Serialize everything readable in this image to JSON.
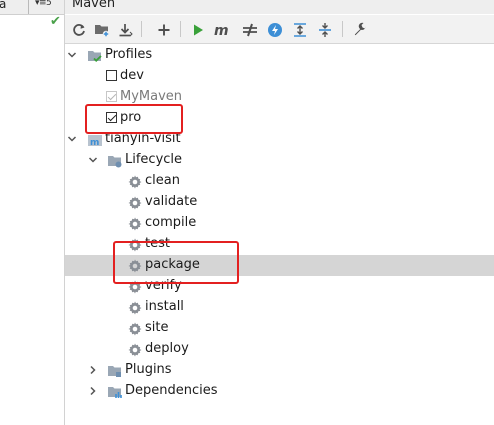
{
  "left_panel": {
    "tab_label": "a",
    "tab_count": "▾≡5"
  },
  "maven": {
    "title": "Maven",
    "toolbar": [
      {
        "name": "reload-icon"
      },
      {
        "name": "add-folder-icon"
      },
      {
        "name": "download-icon"
      },
      {
        "name": "add-icon"
      },
      {
        "name": "run-icon"
      },
      {
        "name": "execute-goal-icon"
      },
      {
        "name": "skip-tests-icon"
      },
      {
        "name": "offline-icon"
      },
      {
        "name": "expand-all-icon"
      },
      {
        "name": "collapse-all-icon"
      },
      {
        "name": "settings-wrench-icon"
      }
    ],
    "tree": {
      "profiles": {
        "label": "Profiles",
        "items": [
          {
            "label": "dev",
            "checked": false,
            "muted": false
          },
          {
            "label": "MyMaven",
            "checked": true,
            "muted": true
          },
          {
            "label": "pro",
            "checked": true,
            "muted": false
          }
        ]
      },
      "project": {
        "label": "tianyin-visit",
        "lifecycle": {
          "label": "Lifecycle",
          "goals": [
            "clean",
            "validate",
            "compile",
            "test",
            "package",
            "verify",
            "install",
            "site",
            "deploy"
          ],
          "selected": "package"
        },
        "plugins": "Plugins",
        "dependencies": "Dependencies"
      }
    }
  },
  "colors": {
    "annotation": "#e32020",
    "selection": "#d5d5d5",
    "run_green": "#3aa13a",
    "accent_blue": "#3d8fd6"
  }
}
